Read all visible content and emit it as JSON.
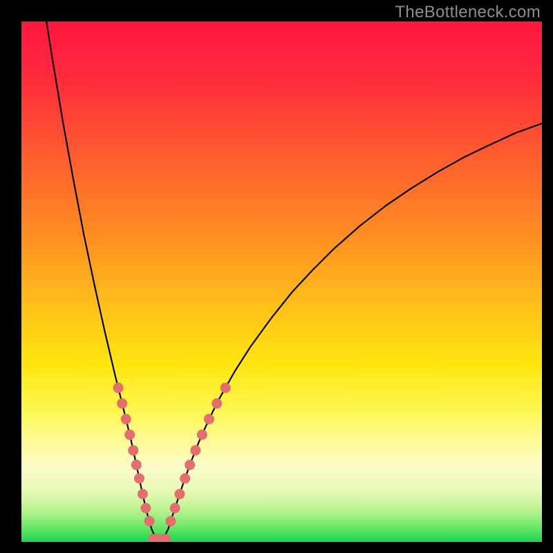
{
  "meta": {
    "watermark": "TheBottleneck.com"
  },
  "chart_data": {
    "type": "line",
    "title": "",
    "xlabel": "",
    "ylabel": "",
    "xlim": [
      0,
      100
    ],
    "ylim": [
      0,
      100
    ],
    "x_min": 26.5,
    "gradient_stops": [
      {
        "offset": 0.0,
        "color": "#ff163f"
      },
      {
        "offset": 0.11,
        "color": "#ff2b3b"
      },
      {
        "offset": 0.25,
        "color": "#ff5a2f"
      },
      {
        "offset": 0.4,
        "color": "#ff8a22"
      },
      {
        "offset": 0.55,
        "color": "#ffc118"
      },
      {
        "offset": 0.66,
        "color": "#ffe60f"
      },
      {
        "offset": 0.755,
        "color": "#fdf858"
      },
      {
        "offset": 0.802,
        "color": "#fdfa92"
      },
      {
        "offset": 0.858,
        "color": "#fbfcca"
      },
      {
        "offset": 0.905,
        "color": "#e4f9b4"
      },
      {
        "offset": 0.942,
        "color": "#b4f38a"
      },
      {
        "offset": 0.97,
        "color": "#6fe868"
      },
      {
        "offset": 0.99,
        "color": "#33dd59"
      },
      {
        "offset": 1.0,
        "color": "#16d552"
      }
    ],
    "series": [
      {
        "name": "bottleneck-curve",
        "points": [
          [
            4.8,
            100.0
          ],
          [
            6.0,
            92.5
          ],
          [
            8.0,
            80.5
          ],
          [
            10.0,
            69.5
          ],
          [
            12.0,
            59.0
          ],
          [
            14.0,
            49.5
          ],
          [
            16.0,
            40.5
          ],
          [
            18.0,
            32.0
          ],
          [
            19.5,
            26.0
          ],
          [
            21.0,
            19.8
          ],
          [
            22.0,
            15.2
          ],
          [
            23.0,
            10.5
          ],
          [
            24.0,
            6.0
          ],
          [
            25.0,
            2.5
          ],
          [
            25.7,
            0.9
          ],
          [
            26.5,
            0.35
          ],
          [
            27.4,
            0.9
          ],
          [
            28.2,
            2.5
          ],
          [
            29.0,
            5.0
          ],
          [
            30.0,
            8.0
          ],
          [
            31.0,
            11.0
          ],
          [
            32.5,
            15.2
          ],
          [
            34.0,
            19.0
          ],
          [
            36.0,
            23.5
          ],
          [
            38.0,
            27.5
          ],
          [
            41.0,
            32.8
          ],
          [
            44.0,
            37.5
          ],
          [
            48.0,
            43.0
          ],
          [
            52.0,
            48.0
          ],
          [
            56.0,
            52.3
          ],
          [
            60.0,
            56.3
          ],
          [
            65.0,
            60.7
          ],
          [
            70.0,
            64.6
          ],
          [
            75.0,
            68.0
          ],
          [
            80.0,
            71.1
          ],
          [
            85.0,
            73.9
          ],
          [
            90.0,
            76.3
          ],
          [
            95.0,
            78.6
          ],
          [
            100.0,
            80.4
          ]
        ]
      }
    ],
    "markers": {
      "color": "#e46e6e",
      "radius_px": 7.5,
      "y_values": [
        4.0,
        6.5,
        9.2,
        12.2,
        14.8,
        17.6,
        20.6,
        23.6,
        26.6,
        29.6
      ]
    }
  }
}
